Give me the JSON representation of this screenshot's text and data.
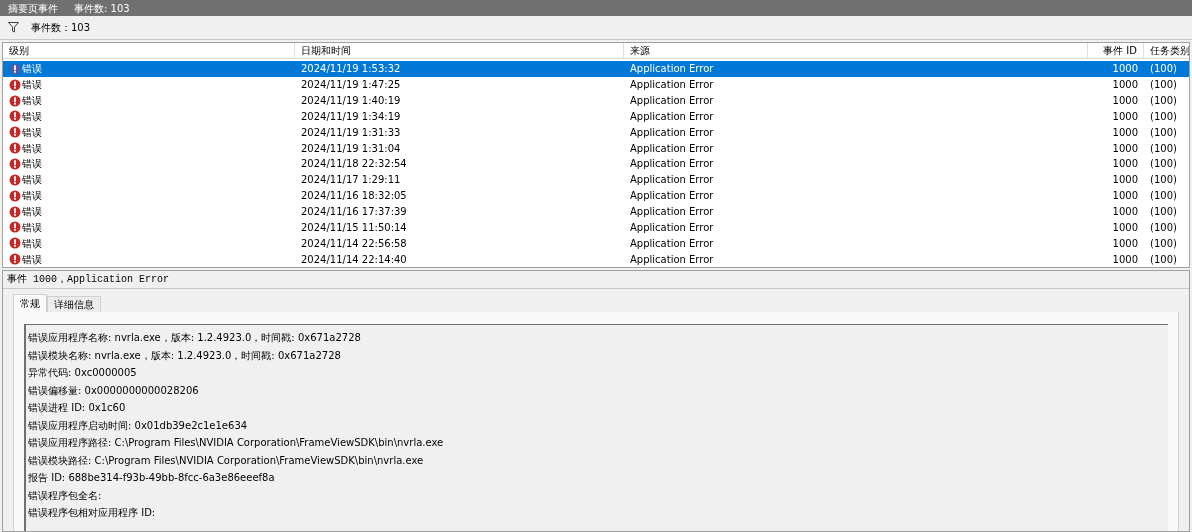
{
  "title_bar": {
    "title": "摘要页事件",
    "count": "事件数: 103"
  },
  "filter_bar": {
    "count": "事件数：103"
  },
  "table": {
    "columns": [
      "级别",
      "日期和时间",
      "来源",
      "事件 ID",
      "任务类别"
    ],
    "rows": [
      {
        "level": "错误",
        "date": "2024/11/19 1:53:32",
        "source": "Application Error",
        "event_id": "1000",
        "category": "(100)",
        "selected": true
      },
      {
        "level": "错误",
        "date": "2024/11/19 1:47:25",
        "source": "Application Error",
        "event_id": "1000",
        "category": "(100)",
        "selected": false
      },
      {
        "level": "错误",
        "date": "2024/11/19 1:40:19",
        "source": "Application Error",
        "event_id": "1000",
        "category": "(100)",
        "selected": false
      },
      {
        "level": "错误",
        "date": "2024/11/19 1:34:19",
        "source": "Application Error",
        "event_id": "1000",
        "category": "(100)",
        "selected": false
      },
      {
        "level": "错误",
        "date": "2024/11/19 1:31:33",
        "source": "Application Error",
        "event_id": "1000",
        "category": "(100)",
        "selected": false
      },
      {
        "level": "错误",
        "date": "2024/11/19 1:31:04",
        "source": "Application Error",
        "event_id": "1000",
        "category": "(100)",
        "selected": false
      },
      {
        "level": "错误",
        "date": "2024/11/18 22:32:54",
        "source": "Application Error",
        "event_id": "1000",
        "category": "(100)",
        "selected": false
      },
      {
        "level": "错误",
        "date": "2024/11/17 1:29:11",
        "source": "Application Error",
        "event_id": "1000",
        "category": "(100)",
        "selected": false
      },
      {
        "level": "错误",
        "date": "2024/11/16 18:32:05",
        "source": "Application Error",
        "event_id": "1000",
        "category": "(100)",
        "selected": false
      },
      {
        "level": "错误",
        "date": "2024/11/16 17:37:39",
        "source": "Application Error",
        "event_id": "1000",
        "category": "(100)",
        "selected": false
      },
      {
        "level": "错误",
        "date": "2024/11/15 11:50:14",
        "source": "Application Error",
        "event_id": "1000",
        "category": "(100)",
        "selected": false
      },
      {
        "level": "错误",
        "date": "2024/11/14 22:56:58",
        "source": "Application Error",
        "event_id": "1000",
        "category": "(100)",
        "selected": false
      },
      {
        "level": "错误",
        "date": "2024/11/14 22:14:40",
        "source": "Application Error",
        "event_id": "1000",
        "category": "(100)",
        "selected": false
      }
    ]
  },
  "detail": {
    "header": "事件 1000，Application Error",
    "tabs": [
      {
        "label": "常规",
        "selected": true
      },
      {
        "label": "详细信息",
        "selected": false
      }
    ],
    "lines": [
      "错误应用程序名称: nvrla.exe，版本: 1.2.4923.0，时间戳: 0x671a2728",
      "错误模块名称: nvrla.exe，版本: 1.2.4923.0，时间戳: 0x671a2728",
      "异常代码: 0xc0000005",
      "错误偏移量: 0x0000000000028206",
      "错误进程 ID: 0x1c60",
      "错误应用程序启动时间: 0x01db39e2c1e1e634",
      "错误应用程序路径: C:\\Program Files\\NVIDIA Corporation\\FrameViewSDK\\bin\\nvrla.exe",
      "错误模块路径: C:\\Program Files\\NVIDIA Corporation\\FrameViewSDK\\bin\\nvrla.exe",
      "报告 ID: 688be314-f93b-49bb-8fcc-6a3e86eeef8a",
      "错误程序包全名:",
      "错误程序包相对应用程序 ID:"
    ]
  }
}
